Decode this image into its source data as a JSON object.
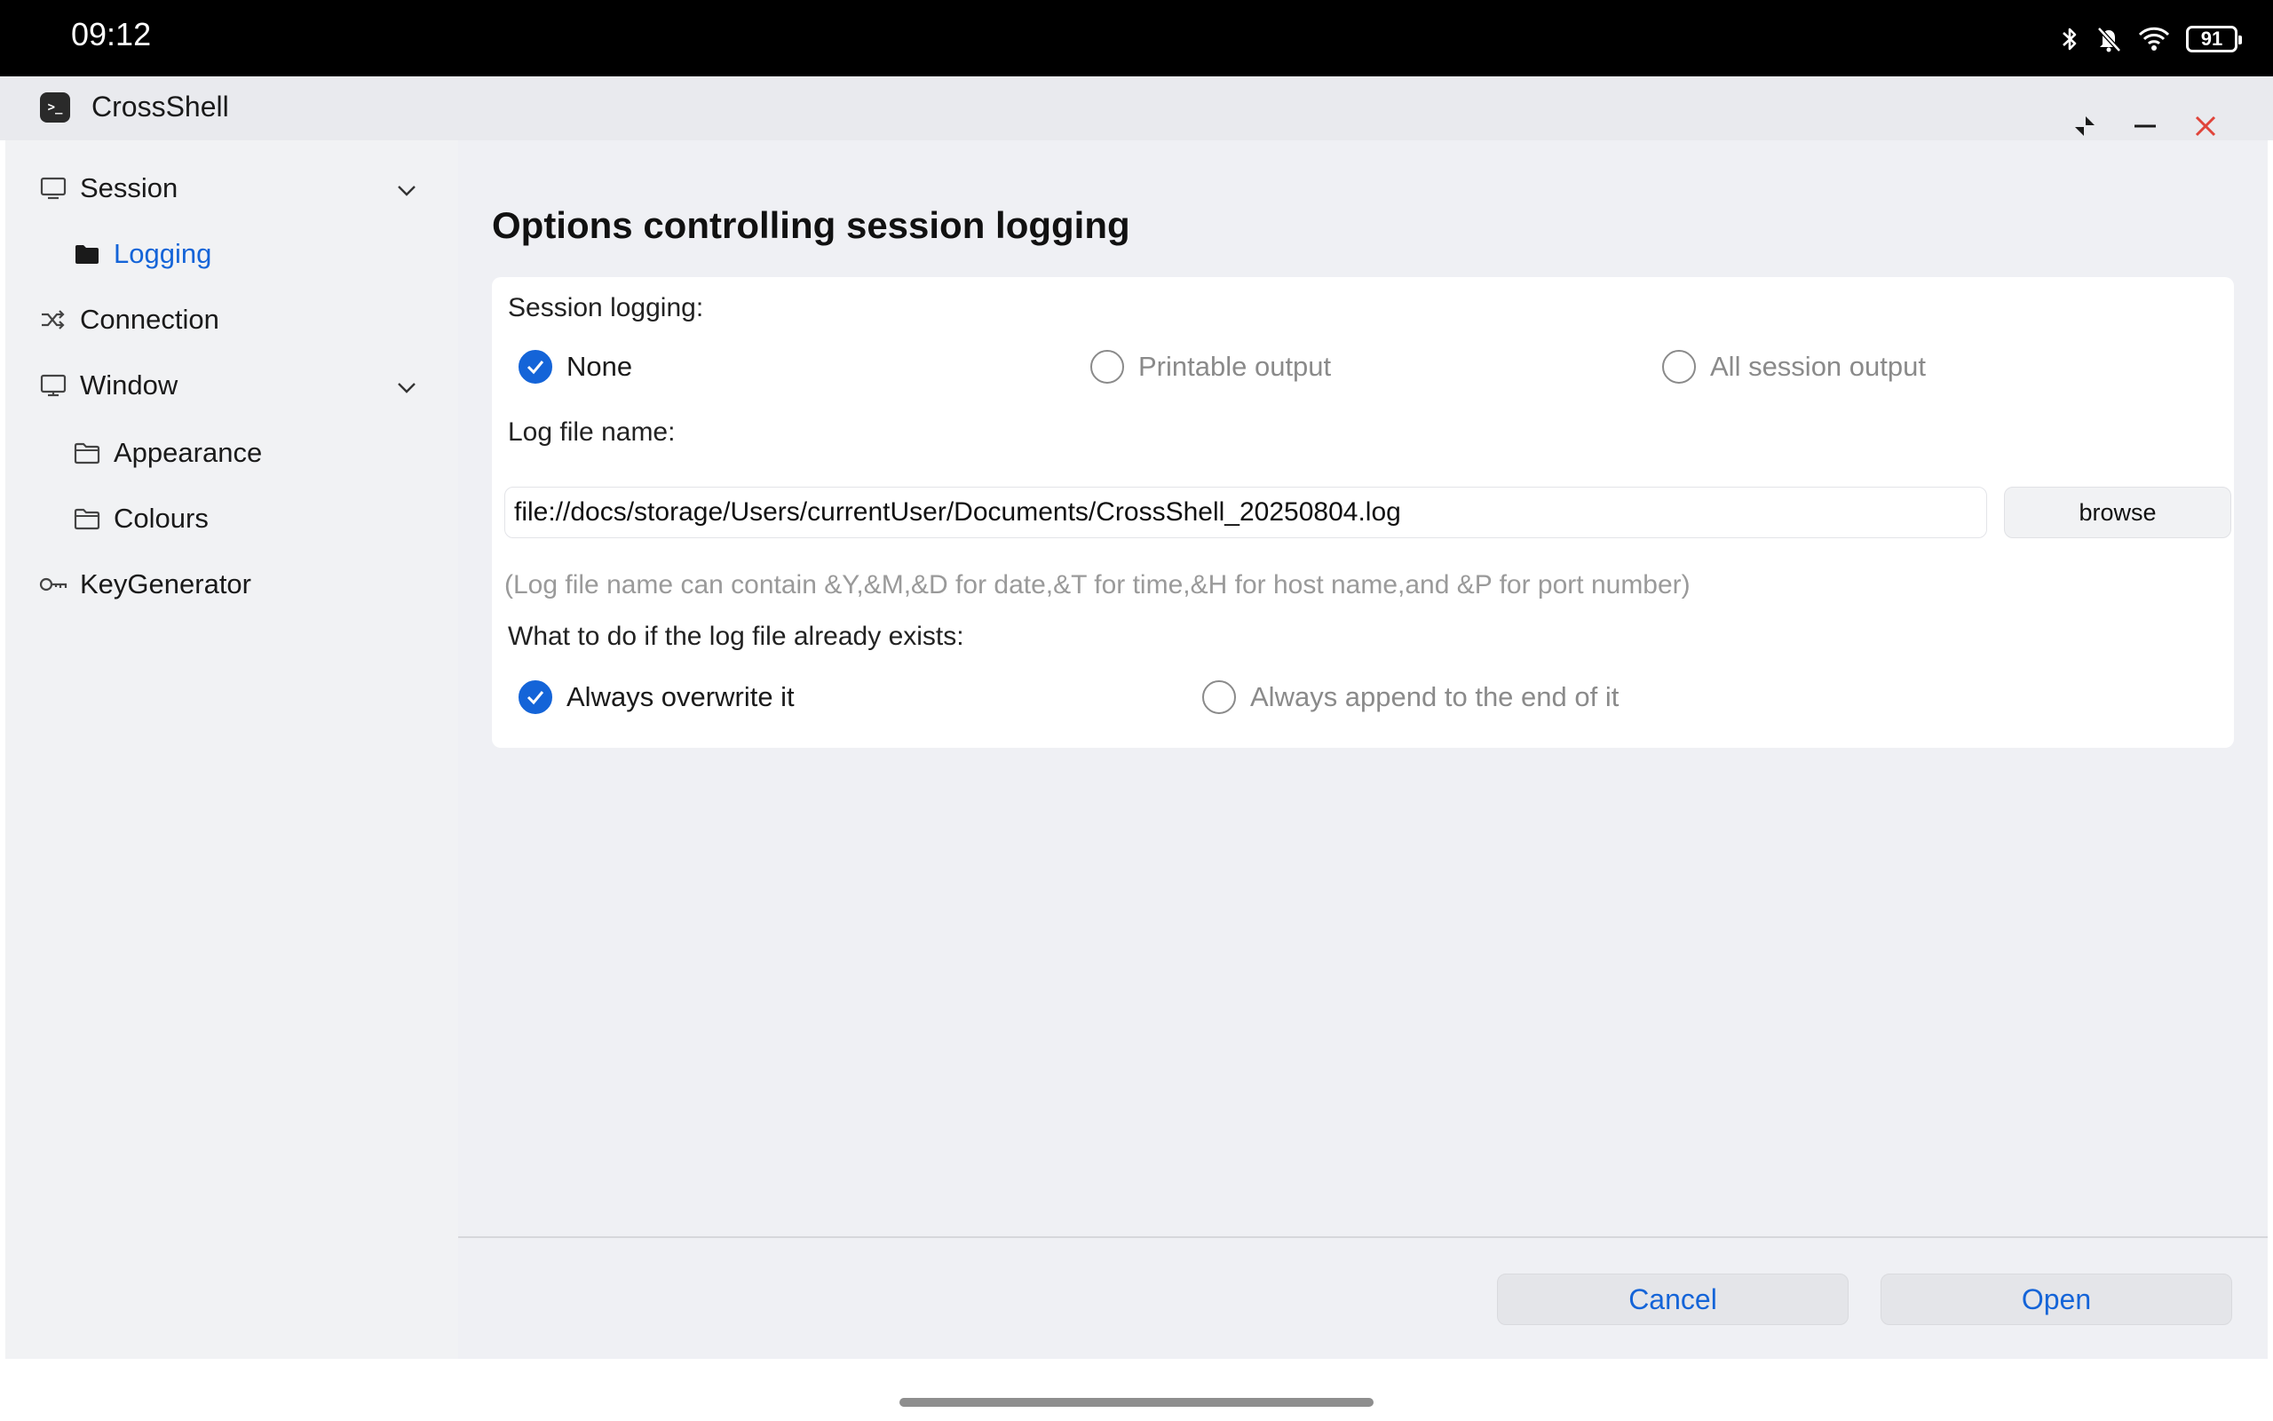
{
  "status_bar": {
    "time": "09:12",
    "battery": "91",
    "icons": [
      "bluetooth-icon",
      "bell-muted-icon",
      "wifi-icon",
      "battery-icon"
    ]
  },
  "window": {
    "title": "CrossShell",
    "app_icon_text": ">_",
    "controls": [
      "restore-icon",
      "minimize-icon",
      "close-icon"
    ]
  },
  "sidebar": {
    "items": [
      {
        "label": "Session",
        "icon": "monitor-icon",
        "expanded": true
      },
      {
        "label": "Logging",
        "icon": "folder-filled-icon",
        "active": true
      },
      {
        "label": "Connection",
        "icon": "shuffle-icon"
      },
      {
        "label": "Window",
        "icon": "monitor-icon",
        "expanded": true
      },
      {
        "label": "Appearance",
        "icon": "folder-icon"
      },
      {
        "label": "Colours",
        "icon": "folder-icon"
      },
      {
        "label": "KeyGenerator",
        "icon": "key-icon"
      }
    ]
  },
  "main": {
    "heading": "Options controlling session logging",
    "session_logging": {
      "label": "Session logging:",
      "options": [
        {
          "label": "None",
          "checked": true
        },
        {
          "label": "Printable output",
          "checked": false
        },
        {
          "label": "All session output",
          "checked": false
        }
      ]
    },
    "log_file": {
      "label": "Log file name:",
      "value": "file://docs/storage/Users/currentUser/Documents/CrossShell_20250804.log",
      "browse_label": "browse",
      "hint": "(Log file name can contain &Y,&M,&D for date,&T for time,&H for host name,and &P for port number)"
    },
    "exists": {
      "label": "What to do if the log file already exists:",
      "options": [
        {
          "label": "Always overwrite it",
          "checked": true
        },
        {
          "label": "Always append to the end of it",
          "checked": false
        }
      ]
    },
    "buttons": {
      "cancel": "Cancel",
      "open": "Open"
    }
  },
  "colors": {
    "accent": "#1464d8",
    "close": "#e0443a",
    "muted_text": "#8a8a8a"
  }
}
